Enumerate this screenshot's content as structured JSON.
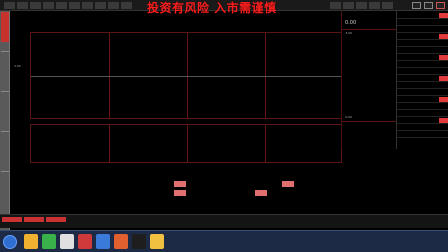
{
  "banner": {
    "text": "投资有风险  入市需谨慎"
  },
  "chart": {
    "title": "",
    "price_scale": [
      "3.00",
      "0.00"
    ],
    "volume_scale": "",
    "tail_label": ""
  },
  "quote": {
    "code": "",
    "price": "0.00",
    "change": "",
    "change_pct": "",
    "rows": [
      {
        "label": "",
        "value": ""
      },
      {
        "label": "",
        "value": ""
      },
      {
        "label": "",
        "value": ""
      },
      {
        "label": "",
        "value": ""
      },
      {
        "label": "",
        "value": ""
      },
      {
        "label": "",
        "value": ""
      },
      {
        "label": "",
        "value": ""
      },
      {
        "label": "",
        "value": ""
      },
      {
        "label": "",
        "value": ""
      },
      {
        "label": "",
        "value": ""
      },
      {
        "label": "",
        "value": ""
      },
      {
        "label": "",
        "value": ""
      }
    ],
    "bottom_rows": [
      {
        "label": "",
        "value": ""
      },
      {
        "label": "",
        "value": ""
      },
      {
        "label": "",
        "value": ""
      }
    ]
  },
  "info_list": [
    {
      "label": "",
      "value": "",
      "tag": ""
    },
    {
      "label": "",
      "value": "",
      "tag": ""
    },
    {
      "label": "",
      "value": "",
      "tag": ""
    },
    {
      "label": "",
      "value": "",
      "tag": ""
    },
    {
      "label": "",
      "value": "",
      "tag": ""
    },
    {
      "label": "",
      "value": "",
      "tag": ""
    },
    {
      "label": "",
      "value": "",
      "tag": ""
    },
    {
      "label": "",
      "value": "",
      "tag": ""
    },
    {
      "label": "",
      "value": "",
      "tag": ""
    },
    {
      "label": "",
      "value": "",
      "tag": ""
    },
    {
      "label": "",
      "value": "",
      "tag": ""
    },
    {
      "label": "",
      "value": "",
      "tag": ""
    },
    {
      "label": "",
      "value": "",
      "tag": ""
    },
    {
      "label": "",
      "value": "",
      "tag": ""
    },
    {
      "label": "",
      "value": "",
      "tag": ""
    },
    {
      "label": "",
      "value": "",
      "tag": ""
    },
    {
      "label": "",
      "value": "",
      "tag": ""
    },
    {
      "label": "",
      "value": "",
      "tag": ""
    }
  ],
  "lower": {
    "header": "",
    "sub_labels": [
      "",
      "",
      "",
      ""
    ],
    "cells": [
      {
        "text": "",
        "red": true
      },
      {
        "text": "",
        "red": false
      },
      {
        "text": "",
        "red": false
      },
      {
        "text": "",
        "red": false
      },
      {
        "text": "",
        "red": true
      },
      {
        "text": "",
        "red": false
      },
      {
        "text": "",
        "red": true
      },
      {
        "text": "",
        "red": false
      },
      {
        "text": "",
        "red": false
      },
      {
        "text": "",
        "red": true
      },
      {
        "text": "",
        "red": false
      },
      {
        "text": "",
        "red": false
      }
    ]
  },
  "status": {
    "tabs": [
      {
        "label": "",
        "red": true
      },
      {
        "label": "",
        "red": true
      },
      {
        "label": "",
        "red": true
      }
    ],
    "tickers": [
      {
        "text": "",
        "color": "#ffffff"
      },
      {
        "text": "",
        "color": "#ffffff"
      },
      {
        "text": "",
        "color": "#32c832"
      },
      {
        "text": "",
        "color": "#32c832"
      },
      {
        "text": "",
        "color": "#ff3c3c"
      },
      {
        "text": "",
        "color": "#ffffff"
      },
      {
        "text": "",
        "color": "#32c832"
      },
      {
        "text": "",
        "color": "#ffd21e"
      }
    ]
  },
  "taskbar": {
    "apps": [
      "#f0b030",
      "#3ab04a",
      "#e0e0e0",
      "#d03a3a",
      "#3a7ad8",
      "#e06030",
      "#1e1e1e",
      "#f0c040"
    ],
    "clock": ""
  },
  "colors": {
    "up": "#ff3c3c",
    "down": "#32c832",
    "grid": "#6b1111",
    "accent": "#ff1e1e"
  }
}
